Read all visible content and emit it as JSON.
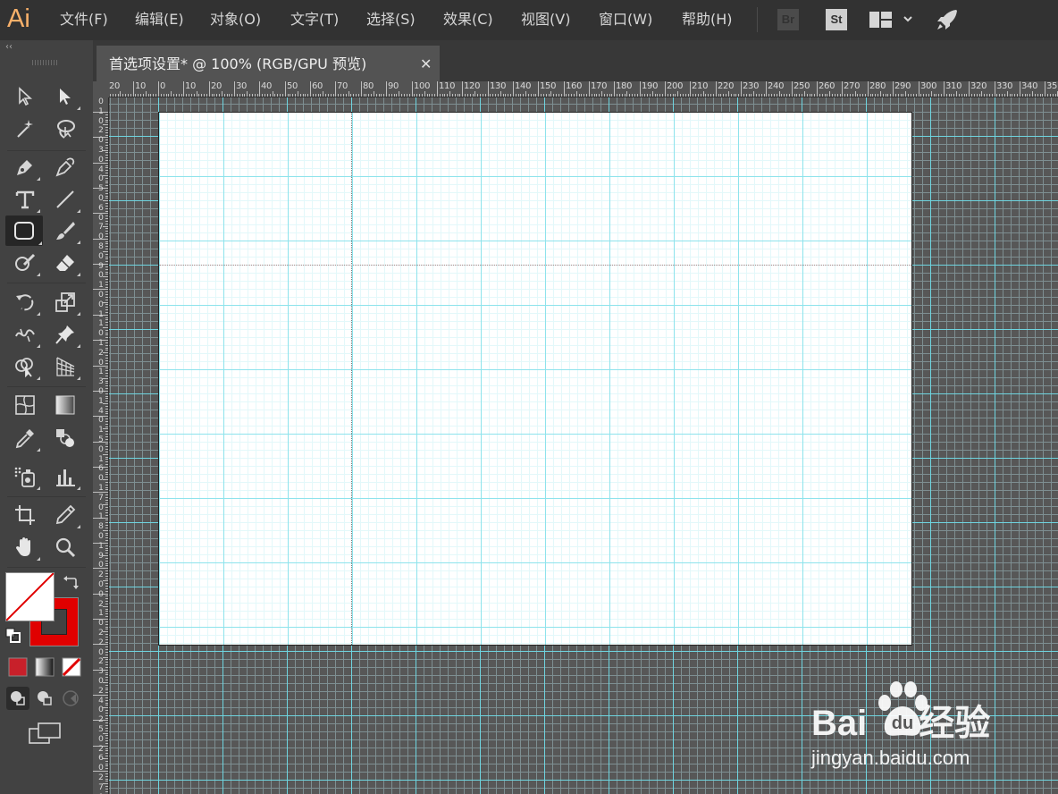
{
  "app": {
    "logo": "Ai"
  },
  "menu": {
    "items": [
      "文件(F)",
      "编辑(E)",
      "对象(O)",
      "文字(T)",
      "选择(S)",
      "效果(C)",
      "视图(V)",
      "窗口(W)",
      "帮助(H)"
    ],
    "bridge_label": "Br",
    "stock_label": "St",
    "workspace_icon": "workspace-layout-icon",
    "publish_icon": "rocket-icon"
  },
  "document": {
    "tab_title": "首选项设置* @ 100% (RGB/GPU 预览)",
    "close_glyph": "✕"
  },
  "toolbar": {
    "collapse_glyph": "‹‹",
    "tools": [
      "selection-tool",
      "direct-selection-tool",
      "magic-wand-tool",
      "lasso-tool",
      "pen-tool",
      "curvature-tool",
      "type-tool",
      "line-segment-tool",
      "rectangle-tool",
      "paintbrush-tool",
      "shaper-tool",
      "eraser-tool",
      "rotate-tool",
      "scale-tool",
      "width-tool",
      "puppet-warp-tool",
      "shape-builder-tool",
      "perspective-grid-tool",
      "mesh-tool",
      "gradient-tool",
      "eyedropper-tool",
      "blend-tool",
      "symbol-sprayer-tool",
      "column-graph-tool",
      "artboard-tool",
      "slice-tool",
      "hand-tool",
      "zoom-tool"
    ],
    "selected_tool": "rectangle-tool",
    "fill": "none",
    "stroke_color": "#e00000"
  },
  "rulers": {
    "horizontal": [
      "20",
      "10",
      "0",
      "10",
      "20",
      "30",
      "40",
      "50",
      "60",
      "70",
      "80",
      "90",
      "100",
      "110",
      "120",
      "130",
      "140",
      "150",
      "160",
      "170",
      "180",
      "190",
      "200",
      "210",
      "220",
      "230",
      "240",
      "250",
      "260",
      "270",
      "280",
      "290",
      "300",
      "310",
      "320",
      "330",
      "340",
      "35"
    ],
    "vertical": [
      "0",
      "1",
      "0",
      "2",
      "0",
      "3",
      "0",
      "4",
      "0",
      "5",
      "0",
      "6",
      "0",
      "7",
      "0",
      "8",
      "0",
      "9",
      "0",
      "1",
      "0",
      "0",
      "1",
      "1",
      "0",
      "1",
      "2",
      "0",
      "1",
      "3",
      "0",
      "1",
      "4",
      "0",
      "1",
      "5",
      "0",
      "1",
      "6",
      "0",
      "1",
      "7",
      "0",
      "1",
      "8",
      "0",
      "1",
      "9",
      "0",
      "2",
      "0",
      "0",
      "2",
      "1",
      "0",
      "2",
      "2",
      "0",
      "2",
      "3",
      "0",
      "2",
      "4",
      "0",
      "2",
      "5",
      "0",
      "2",
      "6",
      "0",
      "2",
      "7",
      "0",
      "2",
      "8"
    ]
  },
  "canvas": {
    "grid_color": "#6ed4df",
    "artboard_color": "#ffffff",
    "zoom": "100%"
  },
  "watermark": {
    "brand": "Bai",
    "url": "jingyan.baidu.com",
    "suffix": "经验"
  }
}
